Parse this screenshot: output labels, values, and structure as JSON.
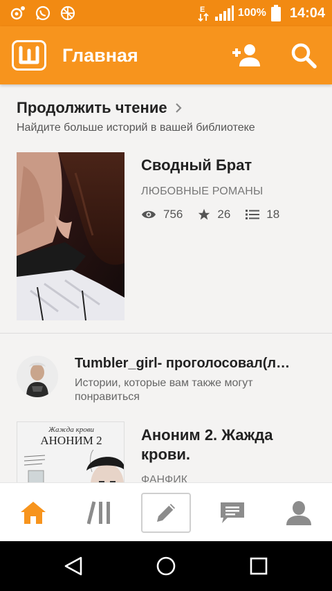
{
  "status_bar": {
    "network_type": "E",
    "battery_percent": "100%",
    "time": "14:04",
    "icons": [
      "notification-icon",
      "whatsapp-icon",
      "vpn-icon",
      "data-transfer-icon",
      "signal-icon",
      "battery-icon"
    ]
  },
  "app_bar": {
    "logo_letter": "W",
    "title": "Главная",
    "add_user_icon": "add-user-icon",
    "search_icon": "search-icon"
  },
  "continue_reading": {
    "title": "Продолжить чтение",
    "subtitle": "Найдите больше историй в вашей библиотеке",
    "story": {
      "title": "Сводный Брат",
      "category": "ЛЮБОВНЫЕ РОМАНЫ",
      "reads": "756",
      "votes": "26",
      "parts": "18"
    }
  },
  "activity": {
    "title": "Tumbler_girl- проголосовал(л…",
    "subtitle": "Истории, которые вам также могут понравиться"
  },
  "recommended_story": {
    "title": "Аноним 2. Жажда крови.",
    "category": "ФАНФИК",
    "cover_title_top": "Жажда крови",
    "cover_title_main": "АНОНИМ 2"
  },
  "tab_bar": {
    "tabs": [
      "home-icon",
      "library-icon",
      "write-icon",
      "messages-icon",
      "profile-icon"
    ],
    "active": "home"
  },
  "colors": {
    "brand": "#f7941d",
    "status_bar": "#f28a12",
    "active_tab": "#f7941d",
    "inactive_tab": "#8c8c8c"
  }
}
